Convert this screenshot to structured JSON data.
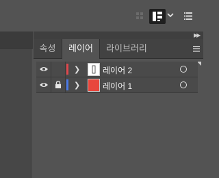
{
  "toolbar": {
    "grid_icon": "grid-dots-icon",
    "arrange_icon": "arrange-documents-icon",
    "chevron_icon": "chevron-down-icon",
    "menu_icon": "list-menu-icon"
  },
  "panel": {
    "collapse_icon": "double-chevron-right-icon",
    "tabs": [
      {
        "label": "속성",
        "active": false
      },
      {
        "label": "레이어",
        "active": true
      },
      {
        "label": "라이브러리",
        "active": false
      }
    ],
    "menu_icon": "panel-menu-icon"
  },
  "layers": [
    {
      "name": "레이어 2",
      "visible": true,
      "locked": false,
      "color": "#e0474c",
      "thumbnail": "white"
    },
    {
      "name": "레이어 1",
      "visible": true,
      "locked": true,
      "color": "#4a7ae8",
      "thumbnail": "red"
    }
  ],
  "colors": {
    "background": "#535353",
    "tab_bar": "#424242",
    "row": "#4a4a4a"
  }
}
